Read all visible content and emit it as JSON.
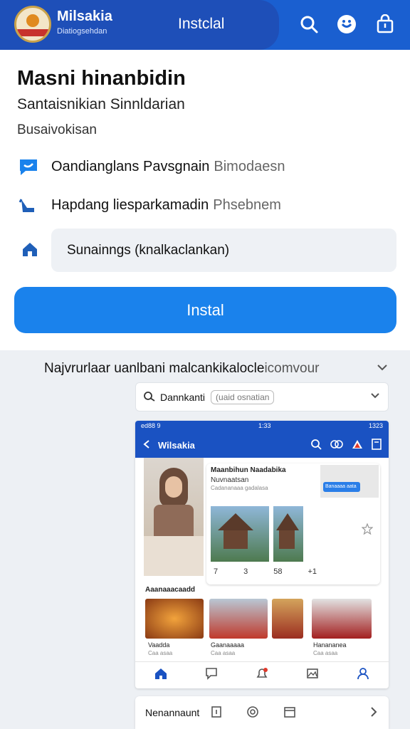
{
  "header": {
    "app_name": "Milsakia",
    "app_subtitle": "Diatiogsehdan",
    "title": "Instclal",
    "icons": [
      "search-icon",
      "smiley-icon",
      "shopping-bag-icon"
    ],
    "color": "#1a5fd0"
  },
  "info": {
    "heading": "Masni hinanbidin",
    "subtitle": "Santaisnikian Sinnldarian",
    "caption": "Busaivokisan",
    "rows": [
      {
        "icon": "chat-icon",
        "text": "Oandianglans Pavsgnain",
        "extra": "Bimodaesn"
      },
      {
        "icon": "hand-icon",
        "text": "Hapdang liesparkamadin",
        "extra": "Phsebnem"
      }
    ],
    "field_value": "Sunainngs (knalkaclankan)",
    "field_icon": "home-icon"
  },
  "install_button": {
    "label": "Instal",
    "color": "#1a82ec"
  },
  "section": {
    "heading": "Najvrurlaar uanlbani malcankikalocle",
    "heading_extra": "icomvour"
  },
  "dropdown": {
    "label": "Dannkanti",
    "chip": "(uaid osnatian"
  },
  "preview": {
    "status_time": "1:33",
    "status_left": "ed88 9",
    "status_right": "1323",
    "app_title": "Wilsakia",
    "card_title": "Maanbihun Naadabika",
    "card_sub": "Nuvnaatsan",
    "card_small": "Cadananaaa gadalasa",
    "ad_button": "Banaaaa aata",
    "counts": [
      "7",
      "3",
      "58",
      "+1"
    ],
    "section_title": "Aaanaaacaadd",
    "food": [
      {
        "label": "Vaadda",
        "sub": "Caa asaa"
      },
      {
        "label": "Gaanaaaaa",
        "sub": "Caa asaa"
      },
      {
        "label": "",
        "sub": ""
      },
      {
        "label": "Hanananea",
        "sub": "Caa asaa"
      }
    ]
  },
  "bottom_bar": {
    "label": "Nenannaunt"
  }
}
